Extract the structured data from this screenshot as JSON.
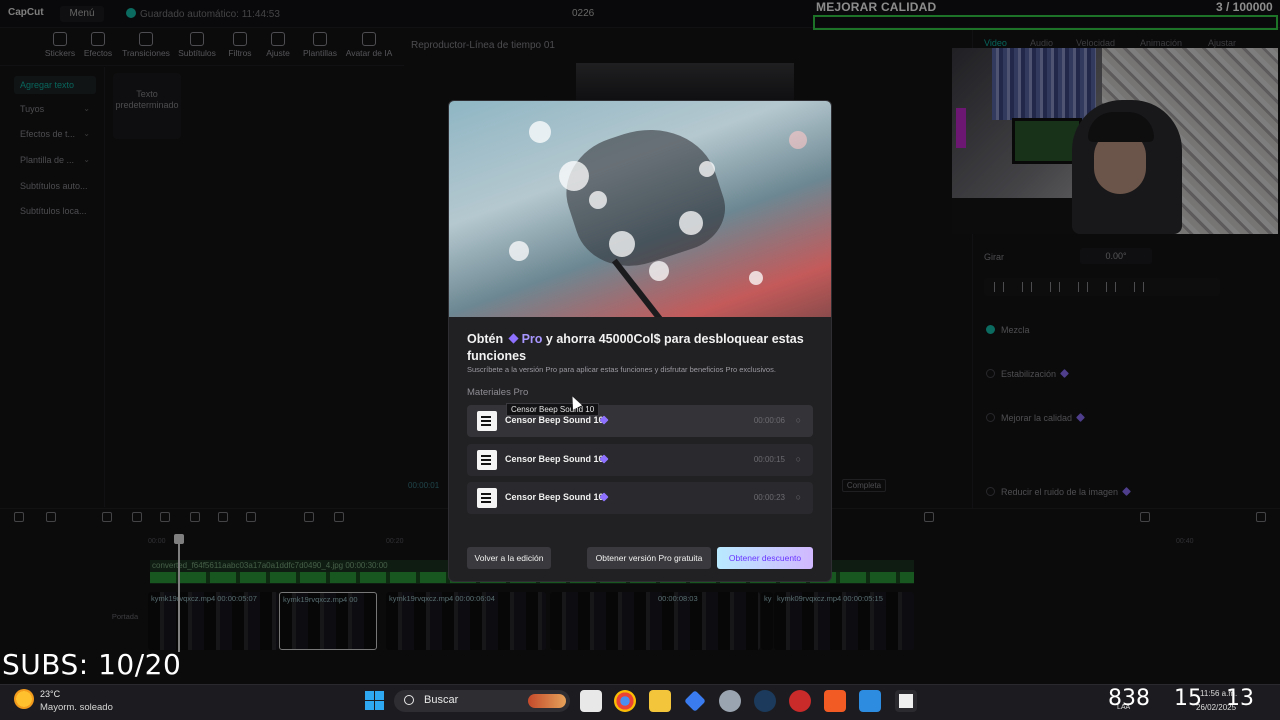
{
  "titlebar": {
    "logo": "CapCut",
    "menu_label": "Menú",
    "autosave": "Guardado automático: 11:44:53",
    "project": "0226"
  },
  "toolbar": {
    "items": [
      "Stickers",
      "Efectos",
      "Transiciones",
      "Subtítulos",
      "Filtros",
      "Ajuste",
      "Plantillas",
      "Avatar de IA"
    ]
  },
  "left_panel": {
    "items": [
      "Agregar texto",
      "Tuyos",
      "Efectos de t...",
      "Plantilla de ...",
      "Subtítulos auto...",
      "Subtítulos loca..."
    ],
    "default_text_card": "Texto predeterminado"
  },
  "player": {
    "title": "Reproductor-Línea de tiempo 01",
    "time": "00:00:01",
    "completa_label": "Completa"
  },
  "right_panel": {
    "tabs": [
      "Video",
      "Audio",
      "Velocidad",
      "Animación",
      "Ajustar"
    ],
    "girar_label": "Girar",
    "girar_value": "0.00°",
    "mezcla_label": "Mezcla",
    "estabilizacion_label": "Estabilización",
    "mejorar_label": "Mejorar la calidad",
    "reducir_label": "Reducir el ruido de la imagen"
  },
  "overlays": {
    "quality_label": "MEJORAR CALIDAD",
    "quality_count": "3 / 100000",
    "subs": "SUBS: 10/20"
  },
  "timeline": {
    "ruler": [
      "00:00",
      "00:20",
      "00:40"
    ],
    "audio_clip": "converted_f64f5611aabc03a17a0a1ddfc7d0490_4.jpg   00:00:30:00",
    "video_clips": [
      {
        "label": "kymk19rvqxcz.mp4   00:00:05:07"
      },
      {
        "label": "kymk19rvqxcz.mp4   00"
      },
      {
        "label": "kymk19rvqxcz.mp4   00:00:06:04"
      },
      {
        "label": "00:00:08:03"
      },
      {
        "label": "ky"
      },
      {
        "label": "kymk09rvqxcz.mp4   00:00:05:15"
      }
    ],
    "portada_label": "Portada"
  },
  "modal": {
    "title_pre": "Obtén",
    "title_pro": "Pro",
    "title_post": "y ahorra 45000Col$ para desbloquear estas funciones",
    "subtitle": "Suscríbete a la versión Pro para aplicar estas funciones y disfrutar beneficios Pro exclusivos.",
    "section": "Materiales Pro",
    "materials": [
      {
        "name": "Censor Beep Sound 10",
        "duration": "00:00:06"
      },
      {
        "name": "Censor Beep Sound 10",
        "duration": "00:00:15"
      },
      {
        "name": "Censor Beep Sound 10",
        "duration": "00:00:23"
      }
    ],
    "tooltip": "Censor Beep Sound 10",
    "btn_back": "Volver a la edición",
    "btn_trial": "Obtener versión Pro gratuita",
    "btn_discount": "Obtener descuento"
  },
  "taskbar": {
    "temp": "23°C",
    "weather": "Mayorm. soleado",
    "search": "Buscar",
    "clock_big_1": "838",
    "clock_big_2": "15",
    "clock_big_3": "13",
    "lang": "LAA",
    "time_small": "11:56 a.m.",
    "date_small": "26/02/2025"
  },
  "colors": {
    "accent": "#0fb7a6",
    "pro_purple": "#8e72ff",
    "quality_bar": "#35d247"
  }
}
